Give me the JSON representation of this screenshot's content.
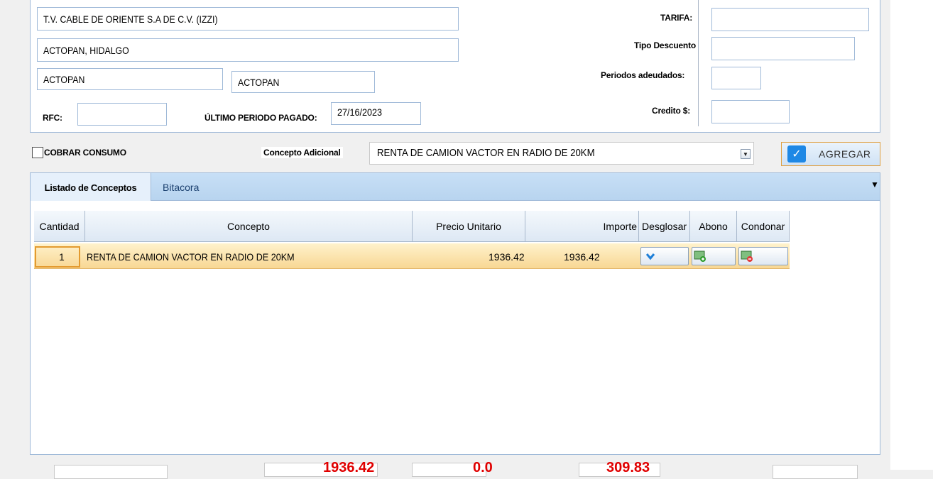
{
  "cliente": {
    "empresa": "T.V. CABLE DE ORIENTE S.A DE C.V. (IZZI)",
    "direccion": "ACTOPAN, HIDALGO",
    "municipio": "ACTOPAN",
    "localidad": "ACTOPAN",
    "rfc_label": "RFC:",
    "rfc_value": "",
    "ultimo_periodo_label": "ÚLTIMO PERIODO PAGADO:",
    "ultimo_periodo_value": "27/16/2023"
  },
  "resumen": {
    "tarifa_label": "TARIFA:",
    "tarifa_value": "",
    "tipo_descuento_label": "Tipo Descuento",
    "tipo_descuento_value": "",
    "periodos_label": "Periodos adeudados:",
    "periodos_value": "",
    "credito_label": "Credito $:",
    "credito_value": ""
  },
  "opciones": {
    "cobrar_consumo_label": "COBRAR CONSUMO",
    "concepto_adicional_label": "Concepto Adicional",
    "concepto_adicional_value": "RENTA DE CAMION VACTOR EN RADIO DE 20KM",
    "agregar_label": "AGREGAR"
  },
  "tabs": [
    {
      "label": "Listado de Conceptos",
      "active": true
    },
    {
      "label": "Bitacora",
      "active": false
    }
  ],
  "table": {
    "headers": [
      "Cantidad",
      "Concepto",
      "Precio Unitario",
      "Importe",
      "Desglosar",
      "Abono",
      "Condonar"
    ],
    "rows": [
      {
        "cantidad": "1",
        "concepto": "RENTA DE CAMION VACTOR EN RADIO DE 20KM",
        "precio_unitario": "1936.42",
        "importe": "1936.42"
      }
    ]
  },
  "totales": {
    "subtotal": "1936.42",
    "descuento": "0.0",
    "iva": "309.83"
  },
  "colors": {
    "accent": "#1e88e5",
    "row_highlight": "#f8d794",
    "total_value": "#e00000"
  }
}
